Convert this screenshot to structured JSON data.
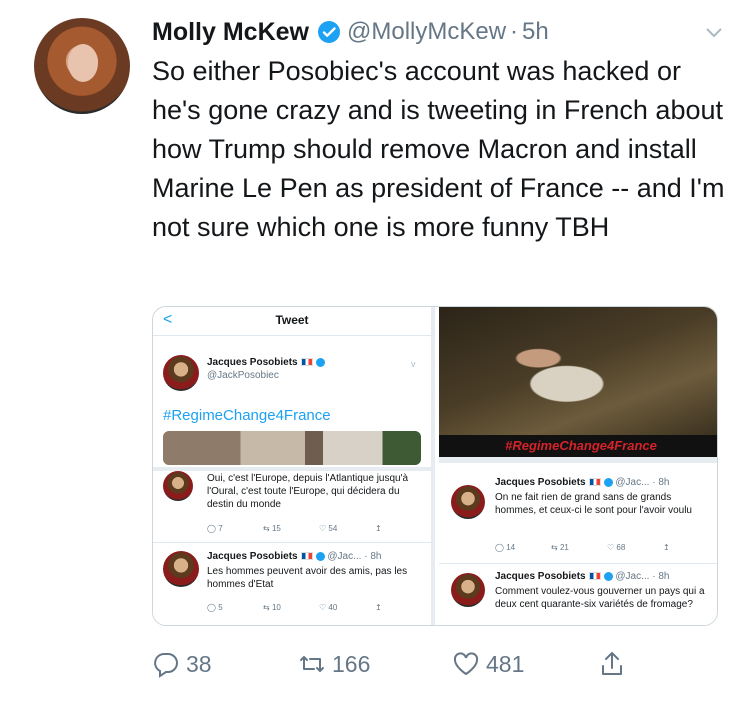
{
  "tweet": {
    "name": "Molly McKew",
    "handle": "@MollyMcKew",
    "dot": "·",
    "time": "5h",
    "text": "So either Posobiec's account was hacked or he's gone crazy and is tweeting in French about how Trump should remove Macron and install Marine Le Pen as president of France -- and I'm not sure which one is more funny TBH",
    "counts": {
      "replies": "38",
      "retweets": "166",
      "likes": "481"
    }
  },
  "media": {
    "left": {
      "title": "Tweet",
      "back": "<",
      "main": {
        "name": "Jacques Posobiets",
        "handle": "@JackPosobiec",
        "hashtag": "#RegimeChange4France"
      },
      "reply1": {
        "text": "Oui, c'est l'Europe, depuis l'Atlantique jusqu'à l'Oural, c'est toute l'Europe, qui décidera du destin du monde",
        "replies": "7",
        "retweets": "15",
        "likes": "54"
      },
      "reply2": {
        "name": "Jacques Posobiets",
        "handle": "@Jac...",
        "time": "· 8h",
        "text": "Les hommes peuvent avoir des amis, pas les hommes d'Etat",
        "replies": "5",
        "retweets": "10",
        "likes": "40"
      }
    },
    "right": {
      "caption": "#RegimeChange4France",
      "reply1": {
        "name": "Jacques Posobiets",
        "handle": "@Jac...",
        "time": "· 8h",
        "text": "On ne fait rien de grand sans de grands hommes, et ceux-ci le sont pour l'avoir voulu",
        "replies": "14",
        "retweets": "21",
        "likes": "68"
      },
      "reply2": {
        "name": "Jacques Posobiets",
        "handle": "@Jac...",
        "time": "· 8h",
        "text": "Comment voulez-vous gouverner un pays qui a deux cent quarante-six variétés de fromage?"
      }
    }
  },
  "colors": {
    "accent": "#1da1f2",
    "muted": "#657786",
    "caption_red": "#d4232a"
  }
}
